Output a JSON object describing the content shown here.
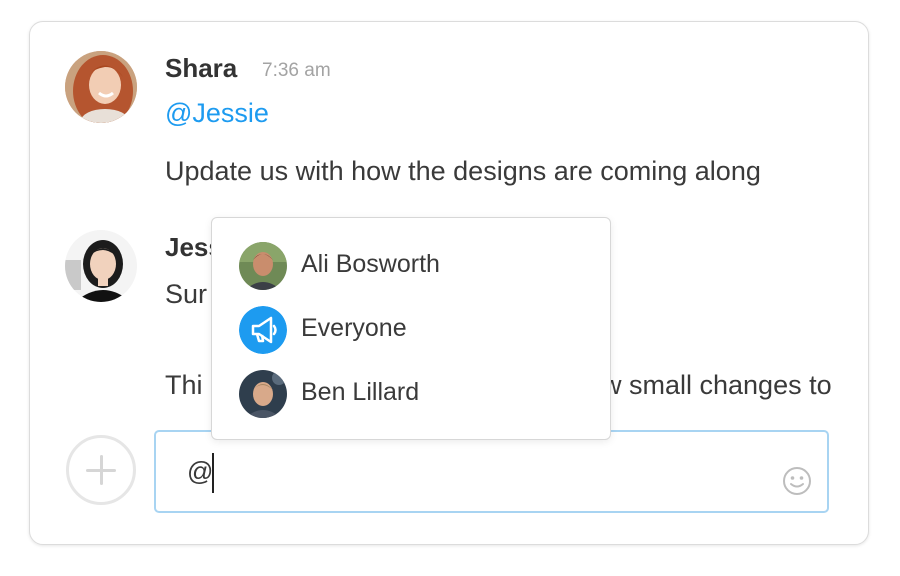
{
  "messages": [
    {
      "author": "Shara",
      "time": "7:36 am",
      "mention": "@Jessie",
      "text": "Update us with how the designs are coming along"
    },
    {
      "author": "Jess",
      "line1": "Sur",
      "line2_start": "Thi",
      "line2_end": "w small changes to"
    }
  ],
  "mention_dropdown": {
    "items": [
      {
        "label": "Ali Bosworth",
        "icon": "user-avatar"
      },
      {
        "label": "Everyone",
        "icon": "megaphone-icon"
      },
      {
        "label": "Ben Lillard",
        "icon": "user-avatar"
      }
    ]
  },
  "composer": {
    "value": "@",
    "add_icon": "plus-icon",
    "emoji_icon": "smiley-icon"
  },
  "colors": {
    "mention": "#1d9bf0",
    "composer_border": "#a8d4f2",
    "everyone_badge": "#1d9bf0"
  }
}
